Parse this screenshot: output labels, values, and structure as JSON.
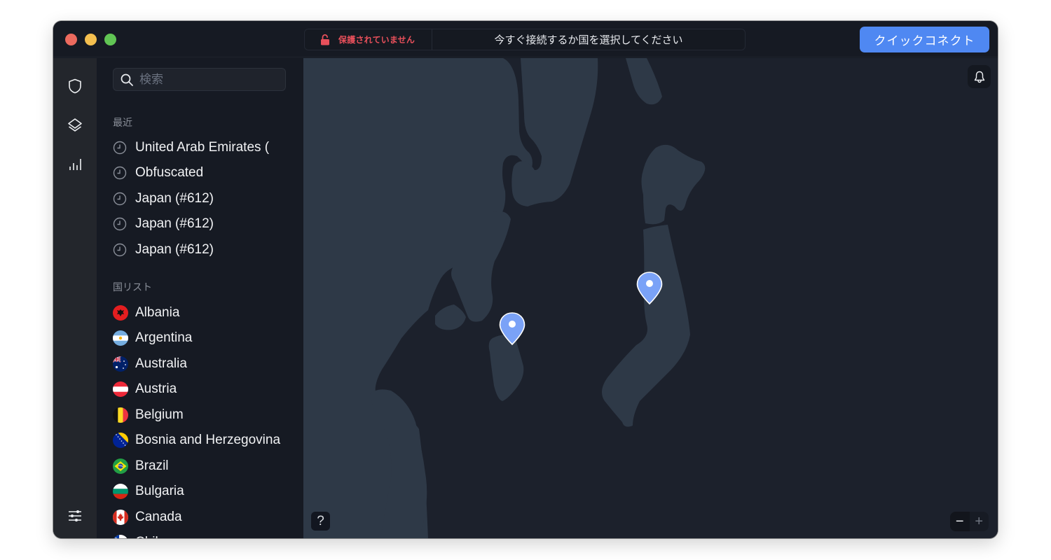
{
  "window": {
    "traffic_lights": [
      "close",
      "minimize",
      "maximize"
    ]
  },
  "titlebar": {
    "status": {
      "icon": "unlocked-padlock-icon",
      "label": "保護されていません",
      "color": "#e8505b"
    },
    "prompt": "今すぐ接続するか国を選択してください",
    "quick_connect_label": "クイックコネクト",
    "accent": "#4f88f2"
  },
  "rail": {
    "items": [
      {
        "icon": "shield-icon",
        "label": "VPN"
      },
      {
        "icon": "layers-icon",
        "label": "Specialty servers"
      },
      {
        "icon": "bar-chart-icon",
        "label": "Statistics"
      }
    ],
    "bottom": {
      "icon": "sliders-icon",
      "label": "Settings"
    }
  },
  "sidebar": {
    "search": {
      "placeholder": "検索",
      "value": ""
    },
    "recent": {
      "title": "最近",
      "items": [
        {
          "label": "United Arab Emirates ("
        },
        {
          "label": "Obfuscated"
        },
        {
          "label": "Japan (#612)"
        },
        {
          "label": "Japan (#612)"
        },
        {
          "label": "Japan (#612)"
        }
      ]
    },
    "countries": {
      "title": "国リスト",
      "items": [
        {
          "label": "Albania",
          "flag": "albania"
        },
        {
          "label": "Argentina",
          "flag": "argentina"
        },
        {
          "label": "Australia",
          "flag": "australia"
        },
        {
          "label": "Austria",
          "flag": "austria"
        },
        {
          "label": "Belgium",
          "flag": "belgium"
        },
        {
          "label": "Bosnia and Herzegovina",
          "flag": "bosnia"
        },
        {
          "label": "Brazil",
          "flag": "brazil"
        },
        {
          "label": "Bulgaria",
          "flag": "bulgaria"
        },
        {
          "label": "Canada",
          "flag": "canada"
        },
        {
          "label": "Chile",
          "flag": "chile"
        }
      ]
    }
  },
  "map": {
    "pins": [
      {
        "name": "server-pin-1",
        "color": "#7aa2f7"
      },
      {
        "name": "server-pin-2",
        "color": "#7aa2f7"
      }
    ],
    "notifications_icon": "bell-icon",
    "help_label": "?",
    "zoom_out_label": "−",
    "zoom_in_label": "+"
  }
}
